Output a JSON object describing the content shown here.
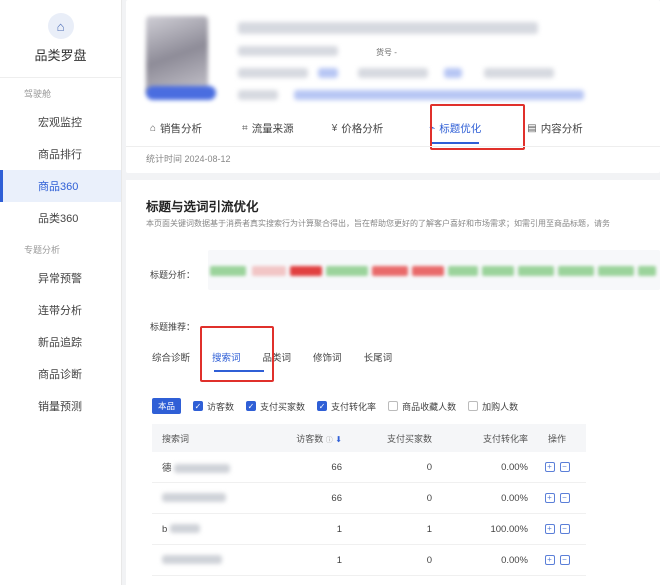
{
  "brand": {
    "title": "品类罗盘",
    "icon": "store-icon"
  },
  "sidebar": {
    "group1": "驾驶舱",
    "items1": [
      {
        "label": "宏观监控"
      },
      {
        "label": "商品排行"
      },
      {
        "label": "商品360"
      },
      {
        "label": "品类360"
      }
    ],
    "group2": "专题分析",
    "items2": [
      {
        "label": "异常预警"
      },
      {
        "label": "连带分析"
      },
      {
        "label": "新品追踪"
      },
      {
        "label": "商品诊断"
      },
      {
        "label": "销量预测"
      }
    ],
    "active": "商品360"
  },
  "product": {
    "id_label": "货号 -"
  },
  "tabs": [
    {
      "label": "销售分析",
      "icon": "bag-icon"
    },
    {
      "label": "流量来源",
      "icon": "line-chart-icon"
    },
    {
      "label": "价格分析",
      "icon": "yen-icon"
    },
    {
      "label": "标题优化",
      "icon": "trend-icon"
    },
    {
      "label": "内容分析",
      "icon": "doc-icon"
    }
  ],
  "stat_time": "统计时间 2024-08-12",
  "section": {
    "title": "标题与选词引流优化",
    "desc": "本页面关键词数据基于消费者真实搜索行为计算聚合得出，旨在帮助您更好的了解客户喜好和市场需求；如需引用至商品标题，请务"
  },
  "labels": {
    "title_analysis": "标题分析：",
    "title_recommend": "标题推荐："
  },
  "subtabs": [
    {
      "label": "综合诊断"
    },
    {
      "label": "搜索词"
    },
    {
      "label": "品类词"
    },
    {
      "label": "修饰词"
    },
    {
      "label": "长尾词"
    }
  ],
  "filters": {
    "chip": "本品",
    "items": [
      {
        "label": "访客数",
        "checked": true
      },
      {
        "label": "支付买家数",
        "checked": true
      },
      {
        "label": "支付转化率",
        "checked": true
      },
      {
        "label": "商品收藏人数",
        "checked": false
      },
      {
        "label": "加购人数",
        "checked": false
      }
    ]
  },
  "table": {
    "headers": {
      "keyword": "搜索词",
      "visitors": "访客数",
      "buyers": "支付买家数",
      "conversion": "支付转化率",
      "actions": "操作"
    },
    "rows": [
      {
        "keyword_prefix": "德",
        "visitors": "66",
        "buyers": "0",
        "conversion": "0.00%"
      },
      {
        "keyword_prefix": "",
        "visitors": "66",
        "buyers": "0",
        "conversion": "0.00%"
      },
      {
        "keyword_prefix": "b",
        "visitors": "1",
        "buyers": "1",
        "conversion": "100.00%"
      },
      {
        "keyword_prefix": "",
        "visitors": "1",
        "buyers": "0",
        "conversion": "0.00%"
      }
    ]
  },
  "colors": {
    "accent": "#2f5fd6",
    "highlight": "#e0302b"
  }
}
